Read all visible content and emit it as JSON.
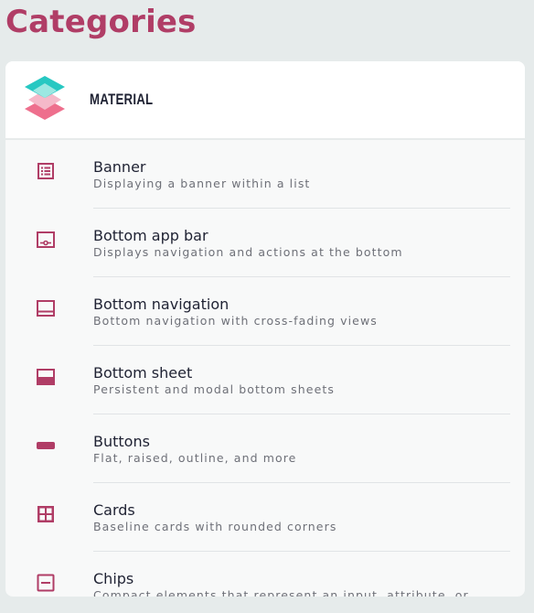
{
  "page": {
    "title": "Categories"
  },
  "colors": {
    "accent": "#b03d66",
    "background": "#e6ebeb",
    "card": "#f8f9f9",
    "text": "#1f2233",
    "muted": "#6e7078"
  },
  "category": {
    "name": "MATERIAL",
    "logo_icon": "material-layers-logo"
  },
  "items": [
    {
      "icon": "list-icon",
      "title": "Banner",
      "description": "Displaying a banner within a list"
    },
    {
      "icon": "bottom-app-bar-icon",
      "title": "Bottom app bar",
      "description": "Displays navigation and actions at the bottom"
    },
    {
      "icon": "bottom-navigation-icon",
      "title": "Bottom navigation",
      "description": "Bottom navigation with cross-fading views"
    },
    {
      "icon": "bottom-sheet-icon",
      "title": "Bottom sheet",
      "description": "Persistent and modal bottom sheets"
    },
    {
      "icon": "button-icon",
      "title": "Buttons",
      "description": "Flat, raised, outline, and more"
    },
    {
      "icon": "cards-icon",
      "title": "Cards",
      "description": "Baseline cards with rounded corners"
    },
    {
      "icon": "chips-icon",
      "title": "Chips",
      "description": "Compact elements that represent an input, attribute, or"
    }
  ]
}
